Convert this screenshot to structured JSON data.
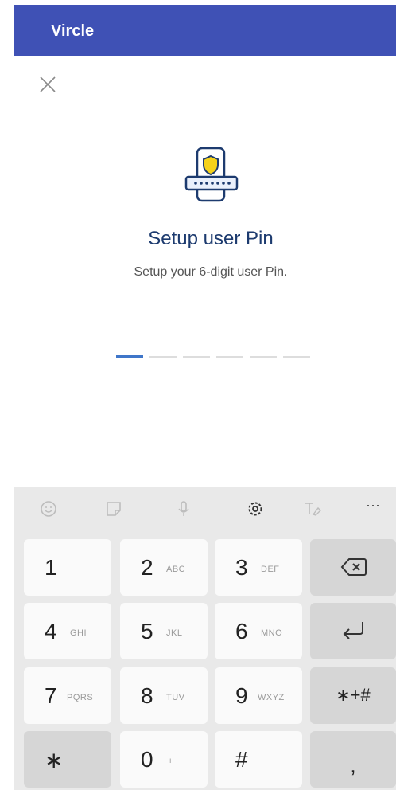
{
  "app": {
    "title": "Vircle"
  },
  "icons": {
    "close": "close-icon",
    "illustration": "secure-pin-icon"
  },
  "setup": {
    "heading": "Setup user Pin",
    "subtitle": "Setup your 6-digit user Pin.",
    "pin_length": 6,
    "pin_active_index": 0
  },
  "keyboard": {
    "toolbar": [
      "emoji-icon",
      "sticker-icon",
      "mic-icon",
      "settings-icon",
      "handwriting-icon",
      "more-icon"
    ],
    "more_label": "···",
    "keys": {
      "k1": {
        "num": "1",
        "letters": ""
      },
      "k2": {
        "num": "2",
        "letters": "ABC"
      },
      "k3": {
        "num": "3",
        "letters": "DEF"
      },
      "k4": {
        "num": "4",
        "letters": "GHI"
      },
      "k5": {
        "num": "5",
        "letters": "JKL"
      },
      "k6": {
        "num": "6",
        "letters": "MNO"
      },
      "k7": {
        "num": "7",
        "letters": "PQRS"
      },
      "k8": {
        "num": "8",
        "letters": "TUV"
      },
      "k9": {
        "num": "9",
        "letters": "WXYZ"
      },
      "k0": {
        "num": "0",
        "letters": "+"
      },
      "star": "∗",
      "hash": "#",
      "symbols": "∗+#",
      "comma": ","
    }
  },
  "colors": {
    "primary": "#3f51b5",
    "accent": "#3f76c9",
    "heading": "#1d3b6f",
    "shield": "#f5d21b"
  }
}
